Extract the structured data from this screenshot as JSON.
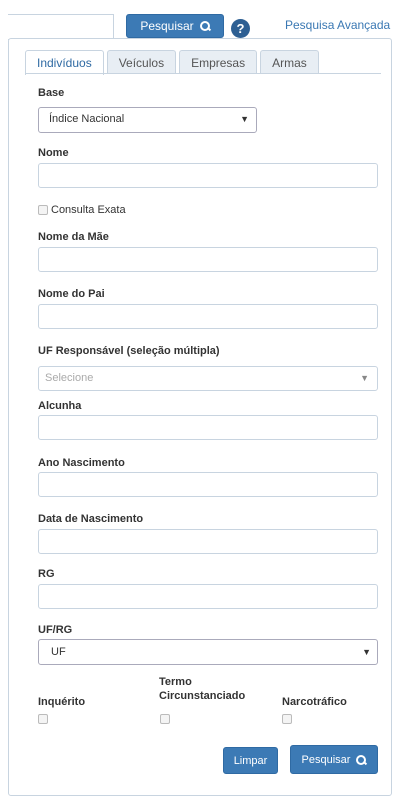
{
  "top": {
    "search_label": "Pesquisar",
    "help_label": "?",
    "advanced_link": "Pesquisa Avançada"
  },
  "tabs": [
    {
      "label": "Indivíduos",
      "active": true
    },
    {
      "label": "Veículos"
    },
    {
      "label": "Empresas"
    },
    {
      "label": "Armas"
    }
  ],
  "form": {
    "base_label": "Base",
    "base_value": "Índice Nacional",
    "nome_label": "Nome",
    "consulta_exata_label": "Consulta Exata",
    "nome_mae_label": "Nome da Mãe",
    "nome_pai_label": "Nome do Pai",
    "uf_resp_label": "UF Responsável (seleção múltipla)",
    "uf_resp_placeholder": "Selecione",
    "alcunha_label": "Alcunha",
    "ano_nasc_label": "Ano Nascimento",
    "data_nasc_label": "Data de Nascimento",
    "rg_label": "RG",
    "ufrg_label": "UF/RG",
    "ufrg_value": "UF",
    "inquerito_label": "Inquérito",
    "termo_label_1": "Termo",
    "termo_label_2": "Circunstanciado",
    "narcotrafico_label": "Narcotráfico",
    "limpar_label": "Limpar",
    "pesquisar_label": "Pesquisar"
  },
  "colors": {
    "primary": "#3c7ab5",
    "link": "#3a78b3",
    "border": "#c8d4e0"
  },
  "icons": [
    "search-icon",
    "help-icon",
    "caret-down-icon"
  ]
}
